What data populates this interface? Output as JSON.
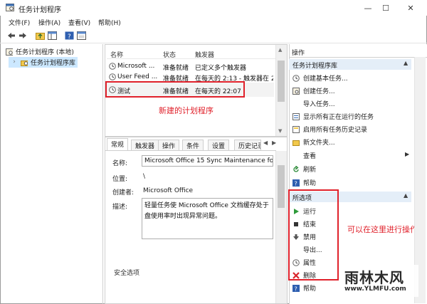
{
  "window": {
    "title": "任务计划程序"
  },
  "window_controls": {
    "minimize": "—",
    "maximize": "☐",
    "close": "✕"
  },
  "menu": [
    "文件(F)",
    "操作(A)",
    "查看(V)",
    "帮助(H)"
  ],
  "tree": {
    "root": "任务计划程序 (本地)",
    "child": "任务计划程序库"
  },
  "task_list": {
    "columns": [
      "名称",
      "状态",
      "触发器"
    ],
    "rows": [
      {
        "name": "Microsoft ...",
        "status": "准备就绪",
        "trigger": "已定义多个触发器"
      },
      {
        "name": "User Feed ...",
        "status": "准备就绪",
        "trigger": "在每天的 2:13 - 触发器在 2025"
      },
      {
        "name": "测试",
        "status": "准备就绪",
        "trigger": "在每天的 22:07"
      }
    ],
    "annotation": "新建的计划程序"
  },
  "detail": {
    "tabs": [
      "常规",
      "触发器",
      "操作",
      "条件",
      "设置",
      "历史记录"
    ],
    "fields": {
      "name_label": "名称:",
      "name_value": "Microsoft Office 15 Sync Maintenance for",
      "location_label": "位置:",
      "location_value": "\\",
      "author_label": "创建者:",
      "author_value": "Microsoft Office",
      "desc_label": "描述:",
      "desc_value_1": "轻量任务使 Microsoft Office 文档缓存处于",
      "desc_value_2": "盘使用率时出现异常问题。",
      "security_label": "安全选项"
    }
  },
  "actions_panel": {
    "title": "操作",
    "library_header": "任务计划程序库",
    "library_items": [
      {
        "label": "创建基本任务...",
        "icon": "basic-task-icon"
      },
      {
        "label": "创建任务...",
        "icon": "create-task-icon"
      },
      {
        "label": "导入任务...",
        "icon": ""
      },
      {
        "label": "显示所有正在运行的任务",
        "icon": "running-tasks-icon"
      },
      {
        "label": "启用所有任务历史记录",
        "icon": "history-icon"
      },
      {
        "label": "新文件夹...",
        "icon": "folder-icon"
      },
      {
        "label": "查看",
        "icon": ""
      },
      {
        "label": "刷新",
        "icon": "refresh-icon"
      },
      {
        "label": "帮助",
        "icon": "help-icon"
      }
    ],
    "selected_header": "所选项",
    "selected_items": [
      {
        "label": "运行",
        "icon": "run-icon"
      },
      {
        "label": "结束",
        "icon": "stop-icon"
      },
      {
        "label": "禁用",
        "icon": "disable-icon"
      },
      {
        "label": "导出...",
        "icon": ""
      },
      {
        "label": "属性",
        "icon": "properties-icon"
      },
      {
        "label": "删除",
        "icon": "delete-icon"
      },
      {
        "label": "帮助",
        "icon": "help-icon"
      }
    ],
    "annotation": "可以在这里进行操作"
  },
  "watermark": {
    "brand": "雨林木风",
    "url": "www.YLMFU.com"
  },
  "colors": {
    "accent_red": "#e0212b",
    "header_blue": "#e4eef8",
    "selection": "#cce8ff"
  }
}
